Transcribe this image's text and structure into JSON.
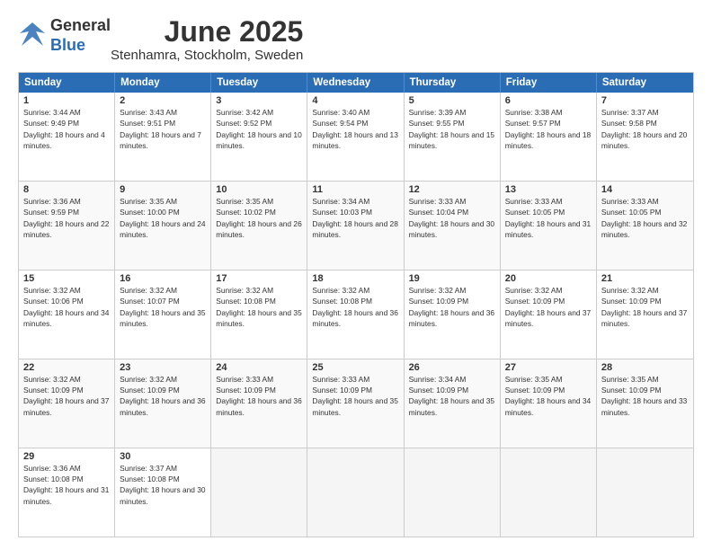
{
  "header": {
    "logo_general": "General",
    "logo_blue": "Blue",
    "title": "June 2025",
    "location": "Stenhamra, Stockholm, Sweden"
  },
  "weekdays": [
    "Sunday",
    "Monday",
    "Tuesday",
    "Wednesday",
    "Thursday",
    "Friday",
    "Saturday"
  ],
  "weeks": [
    [
      {
        "day": "1",
        "sunrise": "Sunrise: 3:44 AM",
        "sunset": "Sunset: 9:49 PM",
        "daylight": "Daylight: 18 hours and 4 minutes."
      },
      {
        "day": "2",
        "sunrise": "Sunrise: 3:43 AM",
        "sunset": "Sunset: 9:51 PM",
        "daylight": "Daylight: 18 hours and 7 minutes."
      },
      {
        "day": "3",
        "sunrise": "Sunrise: 3:42 AM",
        "sunset": "Sunset: 9:52 PM",
        "daylight": "Daylight: 18 hours and 10 minutes."
      },
      {
        "day": "4",
        "sunrise": "Sunrise: 3:40 AM",
        "sunset": "Sunset: 9:54 PM",
        "daylight": "Daylight: 18 hours and 13 minutes."
      },
      {
        "day": "5",
        "sunrise": "Sunrise: 3:39 AM",
        "sunset": "Sunset: 9:55 PM",
        "daylight": "Daylight: 18 hours and 15 minutes."
      },
      {
        "day": "6",
        "sunrise": "Sunrise: 3:38 AM",
        "sunset": "Sunset: 9:57 PM",
        "daylight": "Daylight: 18 hours and 18 minutes."
      },
      {
        "day": "7",
        "sunrise": "Sunrise: 3:37 AM",
        "sunset": "Sunset: 9:58 PM",
        "daylight": "Daylight: 18 hours and 20 minutes."
      }
    ],
    [
      {
        "day": "8",
        "sunrise": "Sunrise: 3:36 AM",
        "sunset": "Sunset: 9:59 PM",
        "daylight": "Daylight: 18 hours and 22 minutes."
      },
      {
        "day": "9",
        "sunrise": "Sunrise: 3:35 AM",
        "sunset": "Sunset: 10:00 PM",
        "daylight": "Daylight: 18 hours and 24 minutes."
      },
      {
        "day": "10",
        "sunrise": "Sunrise: 3:35 AM",
        "sunset": "Sunset: 10:02 PM",
        "daylight": "Daylight: 18 hours and 26 minutes."
      },
      {
        "day": "11",
        "sunrise": "Sunrise: 3:34 AM",
        "sunset": "Sunset: 10:03 PM",
        "daylight": "Daylight: 18 hours and 28 minutes."
      },
      {
        "day": "12",
        "sunrise": "Sunrise: 3:33 AM",
        "sunset": "Sunset: 10:04 PM",
        "daylight": "Daylight: 18 hours and 30 minutes."
      },
      {
        "day": "13",
        "sunrise": "Sunrise: 3:33 AM",
        "sunset": "Sunset: 10:05 PM",
        "daylight": "Daylight: 18 hours and 31 minutes."
      },
      {
        "day": "14",
        "sunrise": "Sunrise: 3:33 AM",
        "sunset": "Sunset: 10:05 PM",
        "daylight": "Daylight: 18 hours and 32 minutes."
      }
    ],
    [
      {
        "day": "15",
        "sunrise": "Sunrise: 3:32 AM",
        "sunset": "Sunset: 10:06 PM",
        "daylight": "Daylight: 18 hours and 34 minutes."
      },
      {
        "day": "16",
        "sunrise": "Sunrise: 3:32 AM",
        "sunset": "Sunset: 10:07 PM",
        "daylight": "Daylight: 18 hours and 35 minutes."
      },
      {
        "day": "17",
        "sunrise": "Sunrise: 3:32 AM",
        "sunset": "Sunset: 10:08 PM",
        "daylight": "Daylight: 18 hours and 35 minutes."
      },
      {
        "day": "18",
        "sunrise": "Sunrise: 3:32 AM",
        "sunset": "Sunset: 10:08 PM",
        "daylight": "Daylight: 18 hours and 36 minutes."
      },
      {
        "day": "19",
        "sunrise": "Sunrise: 3:32 AM",
        "sunset": "Sunset: 10:09 PM",
        "daylight": "Daylight: 18 hours and 36 minutes."
      },
      {
        "day": "20",
        "sunrise": "Sunrise: 3:32 AM",
        "sunset": "Sunset: 10:09 PM",
        "daylight": "Daylight: 18 hours and 37 minutes."
      },
      {
        "day": "21",
        "sunrise": "Sunrise: 3:32 AM",
        "sunset": "Sunset: 10:09 PM",
        "daylight": "Daylight: 18 hours and 37 minutes."
      }
    ],
    [
      {
        "day": "22",
        "sunrise": "Sunrise: 3:32 AM",
        "sunset": "Sunset: 10:09 PM",
        "daylight": "Daylight: 18 hours and 37 minutes."
      },
      {
        "day": "23",
        "sunrise": "Sunrise: 3:32 AM",
        "sunset": "Sunset: 10:09 PM",
        "daylight": "Daylight: 18 hours and 36 minutes."
      },
      {
        "day": "24",
        "sunrise": "Sunrise: 3:33 AM",
        "sunset": "Sunset: 10:09 PM",
        "daylight": "Daylight: 18 hours and 36 minutes."
      },
      {
        "day": "25",
        "sunrise": "Sunrise: 3:33 AM",
        "sunset": "Sunset: 10:09 PM",
        "daylight": "Daylight: 18 hours and 35 minutes."
      },
      {
        "day": "26",
        "sunrise": "Sunrise: 3:34 AM",
        "sunset": "Sunset: 10:09 PM",
        "daylight": "Daylight: 18 hours and 35 minutes."
      },
      {
        "day": "27",
        "sunrise": "Sunrise: 3:35 AM",
        "sunset": "Sunset: 10:09 PM",
        "daylight": "Daylight: 18 hours and 34 minutes."
      },
      {
        "day": "28",
        "sunrise": "Sunrise: 3:35 AM",
        "sunset": "Sunset: 10:09 PM",
        "daylight": "Daylight: 18 hours and 33 minutes."
      }
    ],
    [
      {
        "day": "29",
        "sunrise": "Sunrise: 3:36 AM",
        "sunset": "Sunset: 10:08 PM",
        "daylight": "Daylight: 18 hours and 31 minutes."
      },
      {
        "day": "30",
        "sunrise": "Sunrise: 3:37 AM",
        "sunset": "Sunset: 10:08 PM",
        "daylight": "Daylight: 18 hours and 30 minutes."
      },
      {
        "day": "",
        "sunrise": "",
        "sunset": "",
        "daylight": ""
      },
      {
        "day": "",
        "sunrise": "",
        "sunset": "",
        "daylight": ""
      },
      {
        "day": "",
        "sunrise": "",
        "sunset": "",
        "daylight": ""
      },
      {
        "day": "",
        "sunrise": "",
        "sunset": "",
        "daylight": ""
      },
      {
        "day": "",
        "sunrise": "",
        "sunset": "",
        "daylight": ""
      }
    ]
  ]
}
